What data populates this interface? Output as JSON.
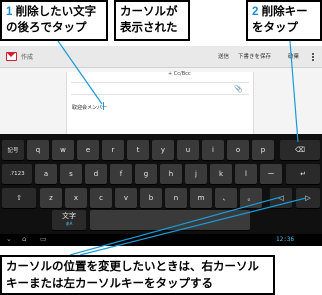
{
  "callouts": {
    "step1": {
      "num": "1",
      "text_line1": "削除したい文字",
      "text_line2": "の後ろでタップ"
    },
    "note_top": {
      "line1": "カーソルが",
      "line2": "表示された"
    },
    "step2": {
      "num": "2",
      "text_line1": "削除キー",
      "text_line2": "をタップ"
    },
    "bottom": {
      "line1": "カーソルの位置を変更したいときは、右カーソル",
      "line2": "キーまたは左カーソルキーをタップする"
    }
  },
  "app": {
    "title": "作成",
    "buttons": [
      "送信",
      "下書きを保存",
      "破棄"
    ],
    "cc_bcc": "+ Cc/Bcc",
    "body_text": "取迎会メンバー"
  },
  "keyboard": {
    "row1": [
      "記号",
      "q",
      "w",
      "e",
      "r",
      "t",
      "y",
      "u",
      "i",
      "o",
      "p",
      "⌫"
    ],
    "row2": [
      ".?123",
      "a",
      "s",
      "d",
      "f",
      "g",
      "h",
      "j",
      "k",
      "l",
      "ー",
      "↵"
    ],
    "row3": [
      "⇧",
      "z",
      "x",
      "c",
      "v",
      "b",
      "n",
      "m",
      "、",
      "。",
      "◁",
      "▷"
    ],
    "row4_left": "文字",
    "row4_left_sub": "あA"
  },
  "navbar": {
    "clock": "12:36"
  },
  "colors": {
    "accent": "#1a8fd4",
    "leader": "#1a9bd8"
  }
}
